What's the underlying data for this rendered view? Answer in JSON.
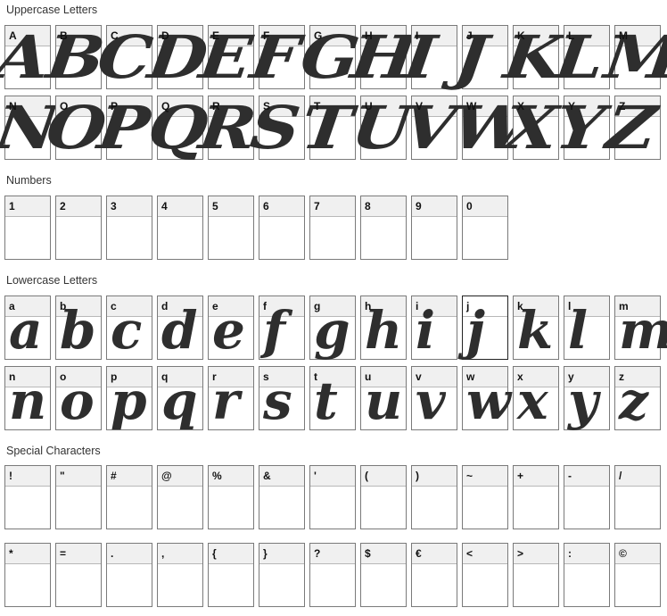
{
  "sections": {
    "uppercase": "Uppercase Letters",
    "numbers": "Numbers",
    "lowercase": "Lowercase Letters",
    "special": "Special Characters"
  },
  "uppercase": [
    "A",
    "B",
    "C",
    "D",
    "E",
    "F",
    "G",
    "H",
    "I",
    "J",
    "K",
    "L",
    "M",
    "N",
    "O",
    "P",
    "Q",
    "R",
    "S",
    "T",
    "U",
    "V",
    "W",
    "X",
    "Y",
    "Z"
  ],
  "numbers": [
    "1",
    "2",
    "3",
    "4",
    "5",
    "6",
    "7",
    "8",
    "9",
    "0"
  ],
  "lowercase": [
    "a",
    "b",
    "c",
    "d",
    "e",
    "f",
    "g",
    "h",
    "i",
    "j",
    "k",
    "l",
    "m",
    "n",
    "o",
    "p",
    "q",
    "r",
    "s",
    "t",
    "u",
    "v",
    "w",
    "x",
    "y",
    "z"
  ],
  "special": [
    "!",
    "\"",
    "#",
    "@",
    "%",
    "&",
    "'",
    "(",
    ")",
    "~",
    "+",
    "-",
    "/",
    "*",
    "=",
    ".",
    ",",
    "{",
    "}",
    "?",
    "$",
    "€",
    "<",
    ">",
    ":",
    "©"
  ]
}
